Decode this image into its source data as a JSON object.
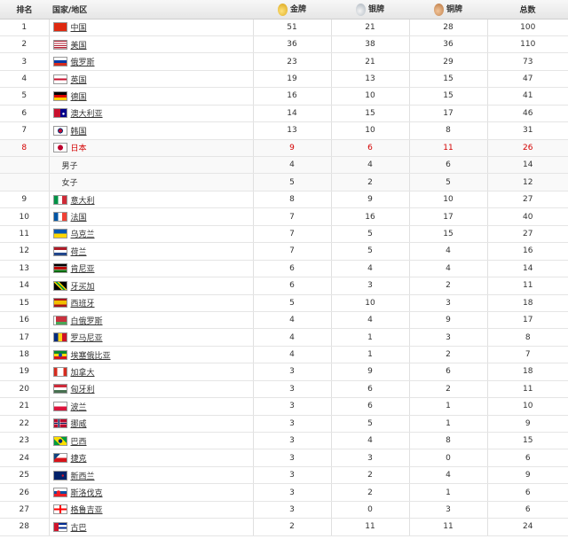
{
  "header": {
    "rank": "排名",
    "country": "国家/地区",
    "gold": "金牌",
    "silver": "银牌",
    "bronze": "铜牌",
    "total": "总数"
  },
  "rows": [
    {
      "rank": "1",
      "name": "中国",
      "gold": "51",
      "silver": "21",
      "bronze": "28",
      "total": "100",
      "flag": "china"
    },
    {
      "rank": "2",
      "name": "美国",
      "gold": "36",
      "silver": "38",
      "bronze": "36",
      "total": "110",
      "flag": "usa"
    },
    {
      "rank": "3",
      "name": "俄罗斯",
      "gold": "23",
      "silver": "21",
      "bronze": "29",
      "total": "73",
      "flag": "russia"
    },
    {
      "rank": "4",
      "name": "英国",
      "gold": "19",
      "silver": "13",
      "bronze": "15",
      "total": "47",
      "flag": "uk"
    },
    {
      "rank": "5",
      "name": "德国",
      "gold": "16",
      "silver": "10",
      "bronze": "15",
      "total": "41",
      "flag": "germany"
    },
    {
      "rank": "6",
      "name": "澳大利亚",
      "gold": "14",
      "silver": "15",
      "bronze": "17",
      "total": "46",
      "flag": "australia"
    },
    {
      "rank": "7",
      "name": "韩国",
      "gold": "13",
      "silver": "10",
      "bronze": "8",
      "total": "31",
      "flag": "korea"
    },
    {
      "rank": "8",
      "name": "日本",
      "gold": "9",
      "silver": "6",
      "bronze": "11",
      "total": "26",
      "flag": "japan",
      "highlight": true
    },
    {
      "rank": "",
      "name": "男子",
      "gold": "4",
      "silver": "4",
      "bronze": "6",
      "total": "14",
      "sub": true
    },
    {
      "rank": "",
      "name": "女子",
      "gold": "5",
      "silver": "2",
      "bronze": "5",
      "total": "12",
      "sub": true
    },
    {
      "rank": "9",
      "name": "意大利",
      "gold": "8",
      "silver": "9",
      "bronze": "10",
      "total": "27",
      "flag": "italy"
    },
    {
      "rank": "10",
      "name": "法国",
      "gold": "7",
      "silver": "16",
      "bronze": "17",
      "total": "40",
      "flag": "france"
    },
    {
      "rank": "11",
      "name": "乌克兰",
      "gold": "7",
      "silver": "5",
      "bronze": "15",
      "total": "27",
      "flag": "ukraine"
    },
    {
      "rank": "12",
      "name": "荷兰",
      "gold": "7",
      "silver": "5",
      "bronze": "4",
      "total": "16",
      "flag": "netherlands"
    },
    {
      "rank": "13",
      "name": "肯尼亚",
      "gold": "6",
      "silver": "4",
      "bronze": "4",
      "total": "14",
      "flag": "kenya"
    },
    {
      "rank": "14",
      "name": "牙买加",
      "gold": "6",
      "silver": "3",
      "bronze": "2",
      "total": "11",
      "flag": "jamaica"
    },
    {
      "rank": "15",
      "name": "西班牙",
      "gold": "5",
      "silver": "10",
      "bronze": "3",
      "total": "18",
      "flag": "spain"
    },
    {
      "rank": "16",
      "name": "白俄罗斯",
      "gold": "4",
      "silver": "4",
      "bronze": "9",
      "total": "17",
      "flag": "belarus"
    },
    {
      "rank": "17",
      "name": "罗马尼亚",
      "gold": "4",
      "silver": "1",
      "bronze": "3",
      "total": "8",
      "flag": "romania"
    },
    {
      "rank": "18",
      "name": "埃塞俄比亚",
      "gold": "4",
      "silver": "1",
      "bronze": "2",
      "total": "7",
      "flag": "ethiopia"
    },
    {
      "rank": "19",
      "name": "加拿大",
      "gold": "3",
      "silver": "9",
      "bronze": "6",
      "total": "18",
      "flag": "canada"
    },
    {
      "rank": "20",
      "name": "匈牙利",
      "gold": "3",
      "silver": "6",
      "bronze": "2",
      "total": "11",
      "flag": "hungary"
    },
    {
      "rank": "21",
      "name": "波兰",
      "gold": "3",
      "silver": "6",
      "bronze": "1",
      "total": "10",
      "flag": "poland"
    },
    {
      "rank": "22",
      "name": "挪威",
      "gold": "3",
      "silver": "5",
      "bronze": "1",
      "total": "9",
      "flag": "norway"
    },
    {
      "rank": "23",
      "name": "巴西",
      "gold": "3",
      "silver": "4",
      "bronze": "8",
      "total": "15",
      "flag": "brazil"
    },
    {
      "rank": "24",
      "name": "捷克",
      "gold": "3",
      "silver": "3",
      "bronze": "0",
      "total": "6",
      "flag": "czech"
    },
    {
      "rank": "25",
      "name": "新西兰",
      "gold": "3",
      "silver": "2",
      "bronze": "4",
      "total": "9",
      "flag": "newzealand"
    },
    {
      "rank": "26",
      "name": "斯洛伐克",
      "gold": "3",
      "silver": "2",
      "bronze": "1",
      "total": "6",
      "flag": "slovakia"
    },
    {
      "rank": "27",
      "name": "格鲁吉亚",
      "gold": "3",
      "silver": "0",
      "bronze": "3",
      "total": "6",
      "flag": "georgia"
    },
    {
      "rank": "28",
      "name": "古巴",
      "gold": "2",
      "silver": "11",
      "bronze": "11",
      "total": "24",
      "flag": "cuba"
    }
  ],
  "colors": {
    "highlight": "#d40000",
    "header_bg": "#ececec",
    "border": "#e5e5e5"
  }
}
